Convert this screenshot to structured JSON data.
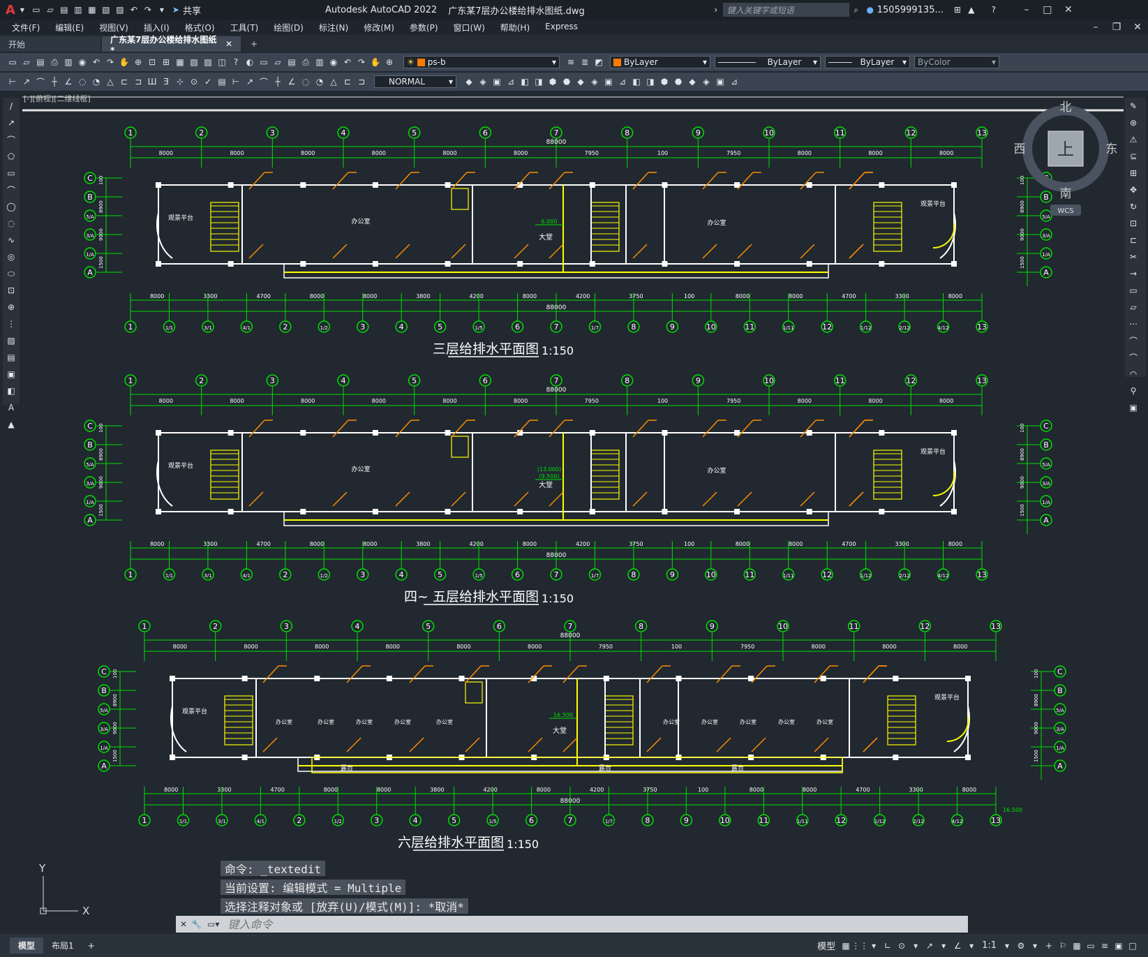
{
  "titlebar": {
    "app_title": "Autodesk AutoCAD 2022",
    "file_name": "广东某7层办公楼给排水图纸.dwg",
    "share_label": "共享",
    "search_placeholder": "键入关键字或短语",
    "user": "1505999135..."
  },
  "menu": [
    "文件(F)",
    "编辑(E)",
    "视图(V)",
    "插入(I)",
    "格式(O)",
    "工具(T)",
    "绘图(D)",
    "标注(N)",
    "修改(M)",
    "参数(P)",
    "窗口(W)",
    "帮助(H)",
    "Express"
  ],
  "tabs": {
    "start": "开始",
    "drawing": "广东某7层办公楼给排水图纸*"
  },
  "ribbon": {
    "layer": "ps-b",
    "color": "ByLayer",
    "linetype": "ByLayer",
    "lineweight": "ByLayer",
    "plotstyle": "ByColor",
    "textstyle": "NORMAL"
  },
  "viewport_label": "[-][俯视][二维线框]",
  "viewcube": {
    "north": "北",
    "south": "南",
    "east": "东",
    "west": "西",
    "face": "上",
    "wcs": "WCS"
  },
  "plans": [
    {
      "title": "三层给排水平面图",
      "scale": "1:150",
      "elev": "6.000",
      "rooms": {
        "office": "办公室",
        "hall": "大堂",
        "balcony": "观景平台"
      }
    },
    {
      "title": "四~ 五层给排水平面图",
      "scale": "1:150",
      "elev": "(13.000)\n(9.500)",
      "rooms": {
        "office": "办公室",
        "hall": "大堂",
        "balcony": "观景平台"
      }
    },
    {
      "title": "六层给排水平面图",
      "scale": "1:150",
      "elev": "16.500",
      "rooms": {
        "office": "办公室",
        "hall": "大堂",
        "balcony": "观景平台",
        "terrace": "露台"
      }
    }
  ],
  "dims": {
    "total": "88000",
    "top": [
      "8000",
      "8000",
      "8000",
      "8000",
      "8000",
      "8000",
      "7950",
      "100",
      "7950",
      "8000",
      "8000",
      "8000"
    ],
    "bottom": [
      "8000",
      "3300",
      "4700",
      "8000",
      "8000",
      "3800",
      "4200",
      "8000",
      "4200",
      "3750",
      "100",
      "8000",
      "8000",
      "4700",
      "3300",
      "8000"
    ],
    "side": [
      "100",
      "8900",
      "9000",
      "1500"
    ]
  },
  "axes": {
    "top": [
      "1",
      "2",
      "3",
      "4",
      "5",
      "6",
      "7",
      "8",
      "9",
      "10",
      "11",
      "12",
      "13"
    ],
    "bottom": [
      "1",
      "1/1",
      "3/1",
      "4/1",
      "2",
      "1/2",
      "3",
      "4",
      "5",
      "1/5",
      "6",
      "7",
      "1/7",
      "8",
      "9",
      "10",
      "11",
      "1/11",
      "12",
      "1/12",
      "2/12",
      "4/12",
      "13"
    ],
    "side": [
      "C",
      "B",
      "5/A",
      "3/A",
      "1/A",
      "A"
    ]
  },
  "command_history": [
    "命令: _textedit",
    "当前设置: 编辑模式 = Multiple",
    "选择注释对象或 [放弃(U)/模式(M)]: *取消*"
  ],
  "command_placeholder": "键入命令",
  "status": {
    "model_tab": "模型",
    "layout_tab": "布局1",
    "model_btn": "模型",
    "scale": "1:1",
    "elev_tag": "16.500"
  },
  "colors": {
    "axis": "#00e000",
    "wall": "#ffffff",
    "pipe": "#ff8c00",
    "accent": "#ffff00",
    "bg": "#212830"
  }
}
